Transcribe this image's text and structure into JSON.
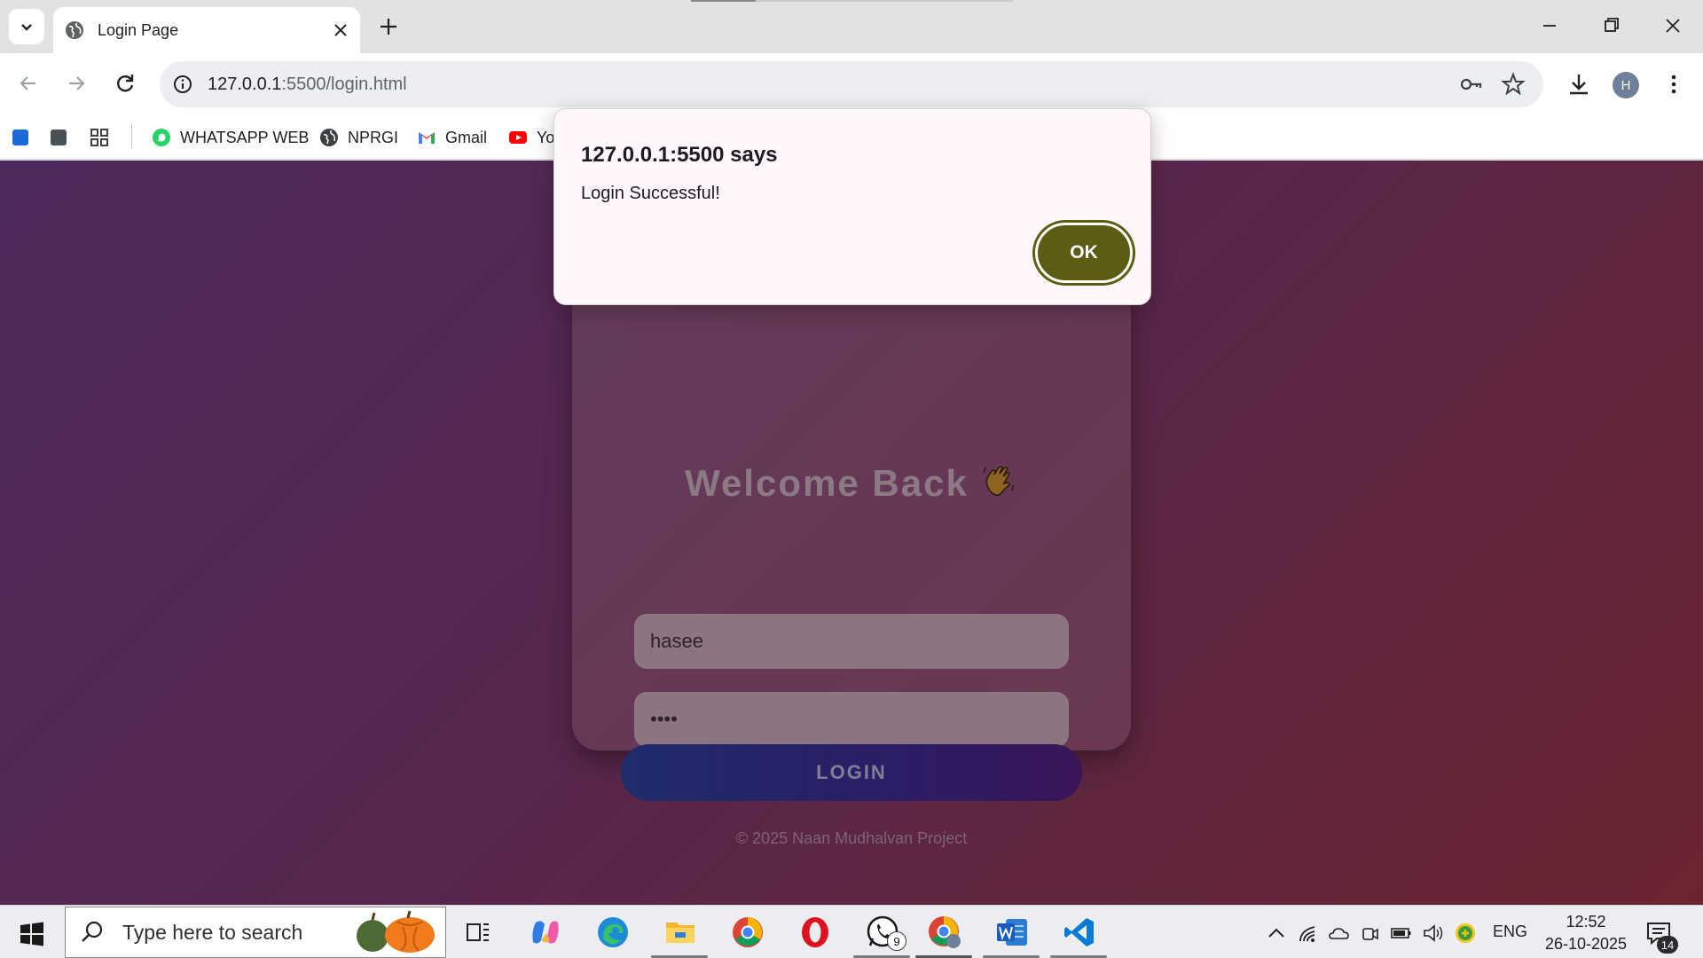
{
  "browser": {
    "tab_title": "Login Page",
    "url_host": "127.0.0.1",
    "url_rest": ":5500/login.html",
    "profile_initial": "H"
  },
  "bookmarks": [
    {
      "label": "WHATSAPP WEB",
      "icon": "whatsapp-icon"
    },
    {
      "label": "NPRGI",
      "icon": "globe-icon"
    },
    {
      "label": "Gmail",
      "icon": "gmail-icon"
    },
    {
      "label": "Yo",
      "icon": "youtube-icon"
    }
  ],
  "login": {
    "title": "Welcome Back",
    "username_value": "hasee",
    "password_value": "••••",
    "button_label": "LOGIN",
    "footer": "© 2025 Naan Mudhalvan Project"
  },
  "dialog": {
    "origin": "127.0.0.1:5500 says",
    "message": "Login Successful!",
    "ok_label": "OK"
  },
  "taskbar": {
    "search_placeholder": "Type here to search",
    "whatsapp_badge": "9",
    "language": "ENG",
    "time": "12:52",
    "date": "26-10-2025",
    "notification_count": "14"
  },
  "colors": {
    "ok_button": "#5c5c13",
    "page_gradient_start": "#4c2a5c",
    "page_gradient_end": "#6a2630"
  }
}
